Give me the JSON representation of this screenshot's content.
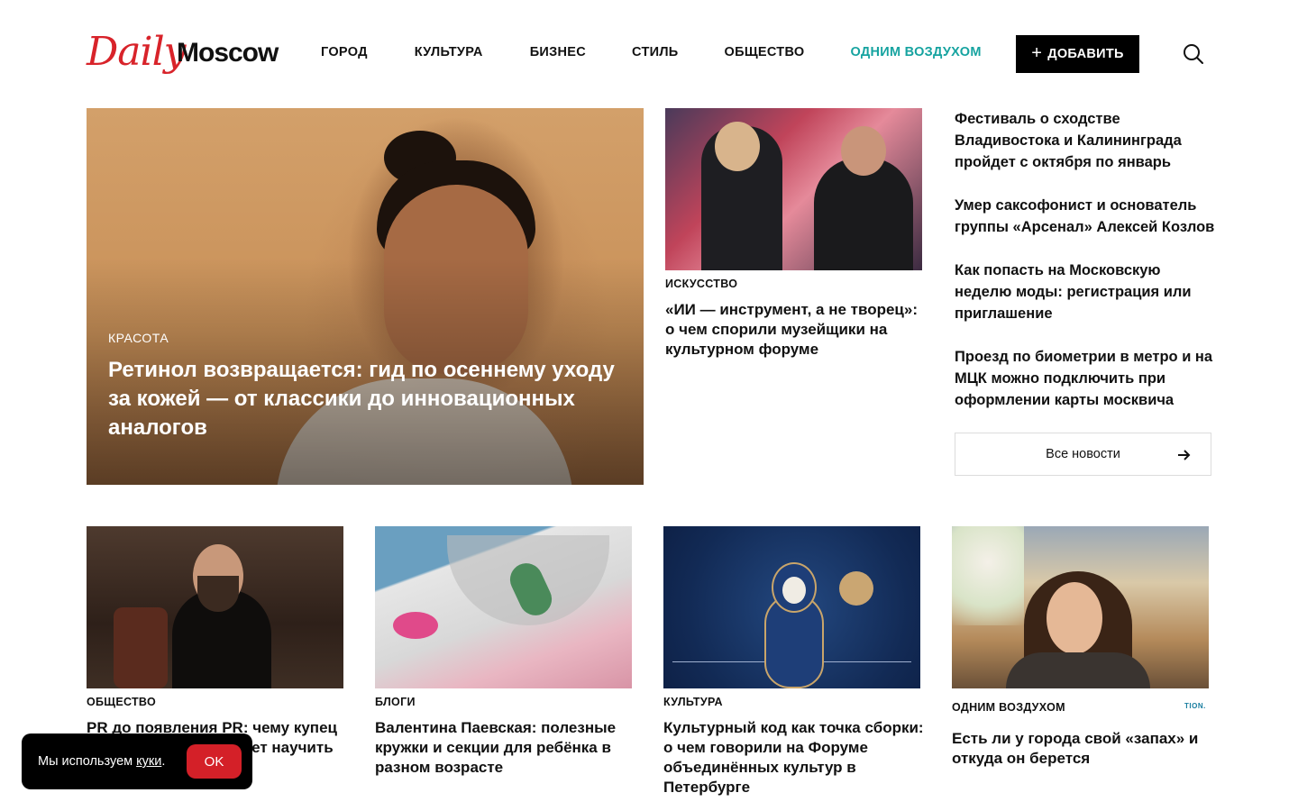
{
  "header": {
    "logo_script": "Daily",
    "logo_word": "Moscow",
    "nav": [
      "ГОРОД",
      "КУЛЬТУРА",
      "БИЗНЕС",
      "СТИЛЬ",
      "ОБЩЕСТВО",
      "ОДНИМ ВОЗДУХОМ"
    ],
    "add_label": "ДОБАВИТЬ",
    "add_icon": "plus-icon",
    "search_icon": "search-icon"
  },
  "hero": {
    "category": "КРАСОТА",
    "title": "Ретинол возвращается: гид по осеннему уходу за кожей — от классики до инновационных аналогов"
  },
  "mid": {
    "category": "ИСКУССТВО",
    "title": "«ИИ — инструмент, а не творец»: о чем спорили музейщики на культурном форуме"
  },
  "news": {
    "items": [
      "Фестиваль о сходстве Владивостока и Калининграда пройдет с октября по январь",
      "Умер саксофонист и основатель группы «Арсенал» Алексей Козлов",
      "Как попасть на Московскую неделю моды: регистрация или приглашение",
      "Проезд по биометрии в метро и на МЦК можно подключить при оформлении карты москвича"
    ],
    "all_label": "Все новости",
    "arrow_icon": "arrow-right-icon"
  },
  "cards": [
    {
      "category": "ОБЩЕСТВО",
      "title": "PR до появления PR: чему купец Павел Третьяков может научить"
    },
    {
      "category": "БЛОГИ",
      "title": "Валентина Паевская: полезные кружки и секции для ребёнка в разном возрасте"
    },
    {
      "category": "КУЛЬТУРА",
      "title": "Культурный код как точка сборки: о чем говорили на Форуме объединённых культур в Петербурге"
    },
    {
      "category": "ОДНИМ ВОЗДУХОМ",
      "title": "Есть ли у города свой «запах» и откуда он берется",
      "partner": "TION."
    }
  ],
  "cookie": {
    "text_before": "Мы используем",
    "link": "куки",
    "text_after": ".",
    "ok": "OK"
  },
  "colors": {
    "brand_red": "#d8232a",
    "accent_teal": "#16a3a0",
    "ok_red": "#d42028"
  }
}
